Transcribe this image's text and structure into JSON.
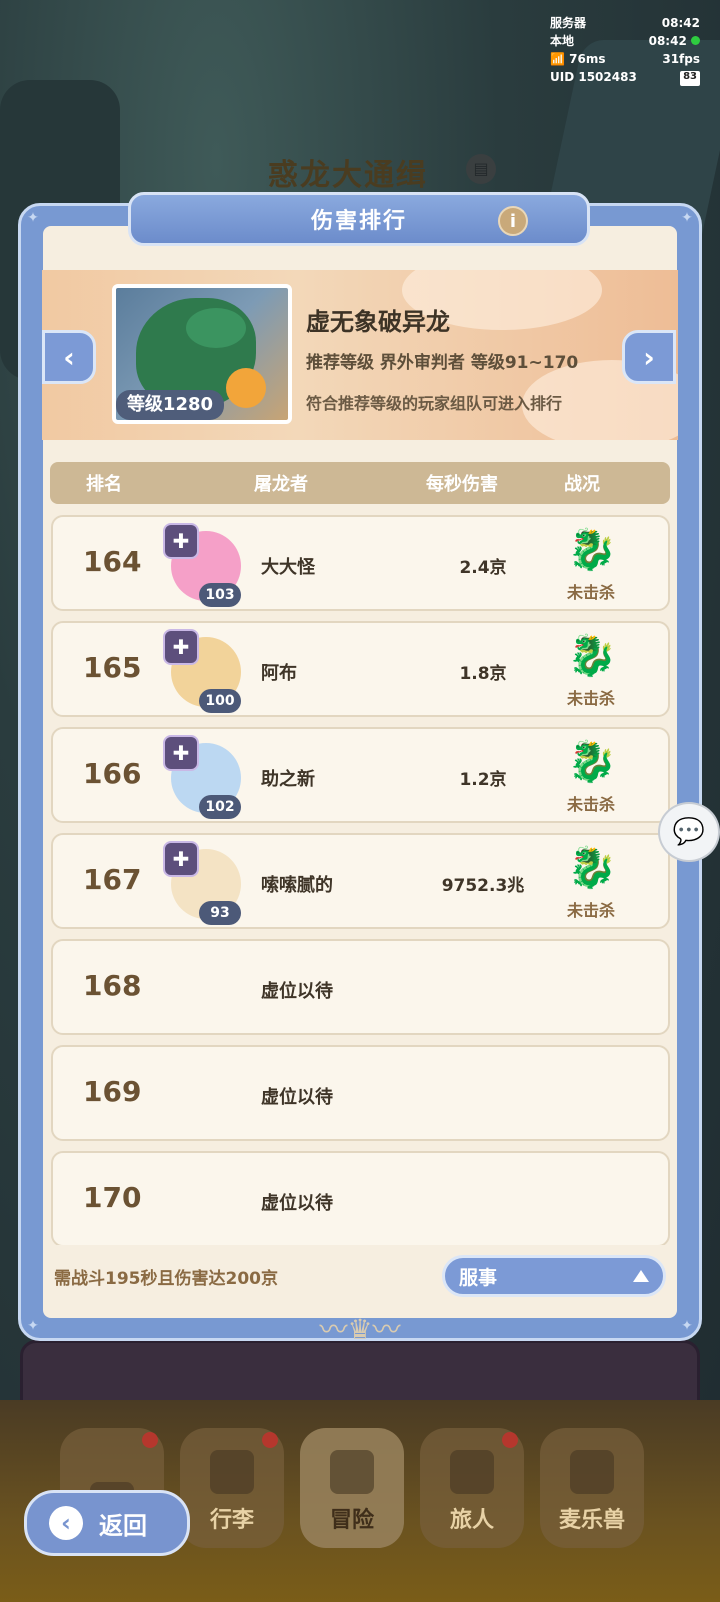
{
  "status": {
    "server_label": "服务器",
    "server_time": "08:42",
    "local_label": "本地",
    "local_time": "08:42",
    "ping": "76ms",
    "fps": "31fps",
    "uid": "UID 1502483",
    "battery": "83"
  },
  "background": {
    "title": "惑龙大通缉",
    "tabs": [
      "行李",
      "冒险",
      "旅人",
      "麦乐兽"
    ]
  },
  "modal": {
    "title": "伤害排行",
    "info_icon": "i",
    "boss": {
      "name": "虚无象破异龙",
      "level_badge": "等级1280",
      "recommend": "推荐等级  界外审判者  等级91~170",
      "note": "符合推荐等级的玩家组队可进入排行"
    },
    "columns": [
      "排名",
      "屠龙者",
      "每秒伤害",
      "战况"
    ],
    "rows": [
      {
        "rank": "164",
        "name": "大大怪",
        "level": "103",
        "dps": "2.4京",
        "status": "未击杀",
        "avatar_color": "#f5a0c8"
      },
      {
        "rank": "165",
        "name": "阿布",
        "level": "100",
        "dps": "1.8京",
        "status": "未击杀",
        "avatar_color": "#f2d39a"
      },
      {
        "rank": "166",
        "name": "助之新",
        "level": "102",
        "dps": "1.2京",
        "status": "未击杀",
        "avatar_color": "#bcd8f2"
      },
      {
        "rank": "167",
        "name": "嗦嗦腻的",
        "level": "93",
        "dps": "9752.3兆",
        "status": "未击杀",
        "avatar_color": "#f4e3c4"
      },
      {
        "rank": "168",
        "name": "虚位以待"
      },
      {
        "rank": "169",
        "name": "虚位以待"
      },
      {
        "rank": "170",
        "name": "虚位以待"
      }
    ],
    "requirement": "需战斗195秒且伤害达200京",
    "server_select": "服事"
  },
  "back_button": "返回"
}
